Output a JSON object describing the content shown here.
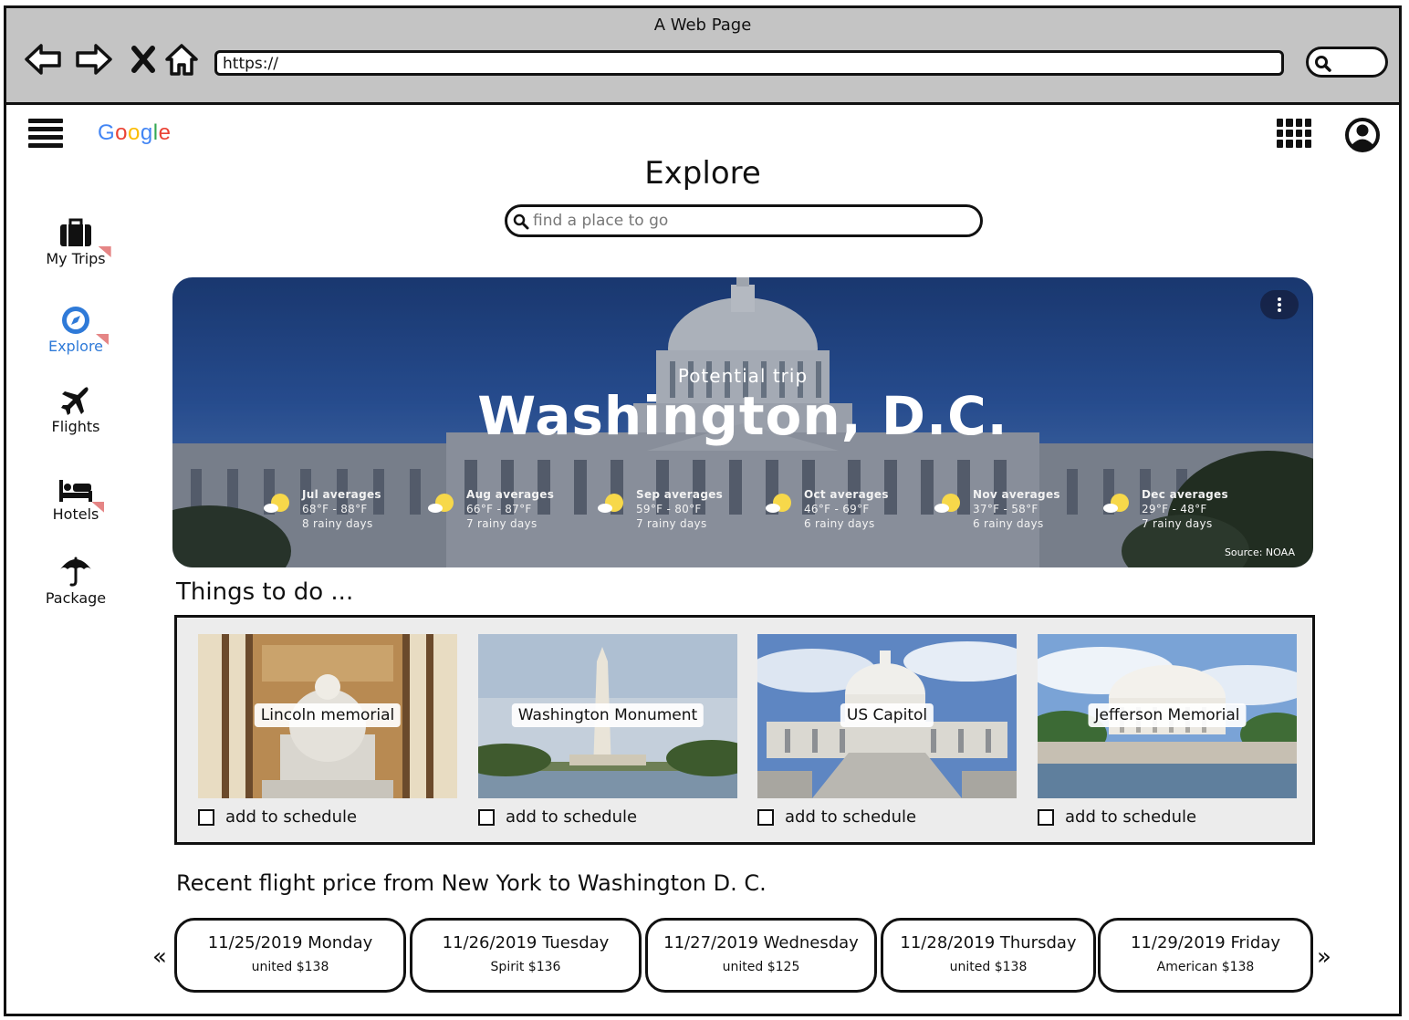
{
  "window": {
    "title": "A Web Page",
    "url": "https://"
  },
  "header": {
    "logo": "Google",
    "search_placeholder": "find a place to go",
    "page_title": "Explore"
  },
  "sidebar": {
    "items": [
      {
        "label": "My Trips",
        "icon": "suitcase-icon"
      },
      {
        "label": "Explore",
        "icon": "compass-icon",
        "active": true
      },
      {
        "label": "Flights",
        "icon": "airplane-icon"
      },
      {
        "label": "Hotels",
        "icon": "bed-icon"
      },
      {
        "label": "Package",
        "icon": "umbrella-icon"
      }
    ]
  },
  "hero": {
    "kicker": "Potential trip",
    "city": "Washington, D.C.",
    "source": "Source: NOAA",
    "months": [
      {
        "title": "Jul averages",
        "range": "68°F - 88°F",
        "rain": "8 rainy days"
      },
      {
        "title": "Aug averages",
        "range": "66°F - 87°F",
        "rain": "7 rainy days"
      },
      {
        "title": "Sep averages",
        "range": "59°F - 80°F",
        "rain": "7 rainy days"
      },
      {
        "title": "Oct averages",
        "range": "46°F - 69°F",
        "rain": "6 rainy days"
      },
      {
        "title": "Nov averages",
        "range": "37°F - 58°F",
        "rain": "6 rainy days"
      },
      {
        "title": "Dec averages",
        "range": "29°F - 48°F",
        "rain": "7 rainy days"
      }
    ]
  },
  "things": {
    "title": "Things to do ...",
    "checkbox_label": "add to schedule",
    "items": [
      {
        "name": "Lincoln memorial"
      },
      {
        "name": "Washington Monument"
      },
      {
        "name": "US Capitol"
      },
      {
        "name": "Jefferson Memorial"
      }
    ]
  },
  "flights": {
    "title": "Recent flight price from New York to Washington D. C.",
    "prev": "«",
    "next": "»",
    "items": [
      {
        "date": "11/25/2019 Monday",
        "price": "united $138"
      },
      {
        "date": "11/26/2019 Tuesday",
        "price": "Spirit $136"
      },
      {
        "date": "11/27/2019 Wednesday",
        "price": "united $125"
      },
      {
        "date": "11/28/2019 Thursday",
        "price": "united $138"
      },
      {
        "date": "11/29/2019 Friday",
        "price": "American $138"
      }
    ]
  },
  "colors": {
    "accent": "#2f7ad8",
    "chrome": "#c4c4c4",
    "panel": "#ececec"
  }
}
